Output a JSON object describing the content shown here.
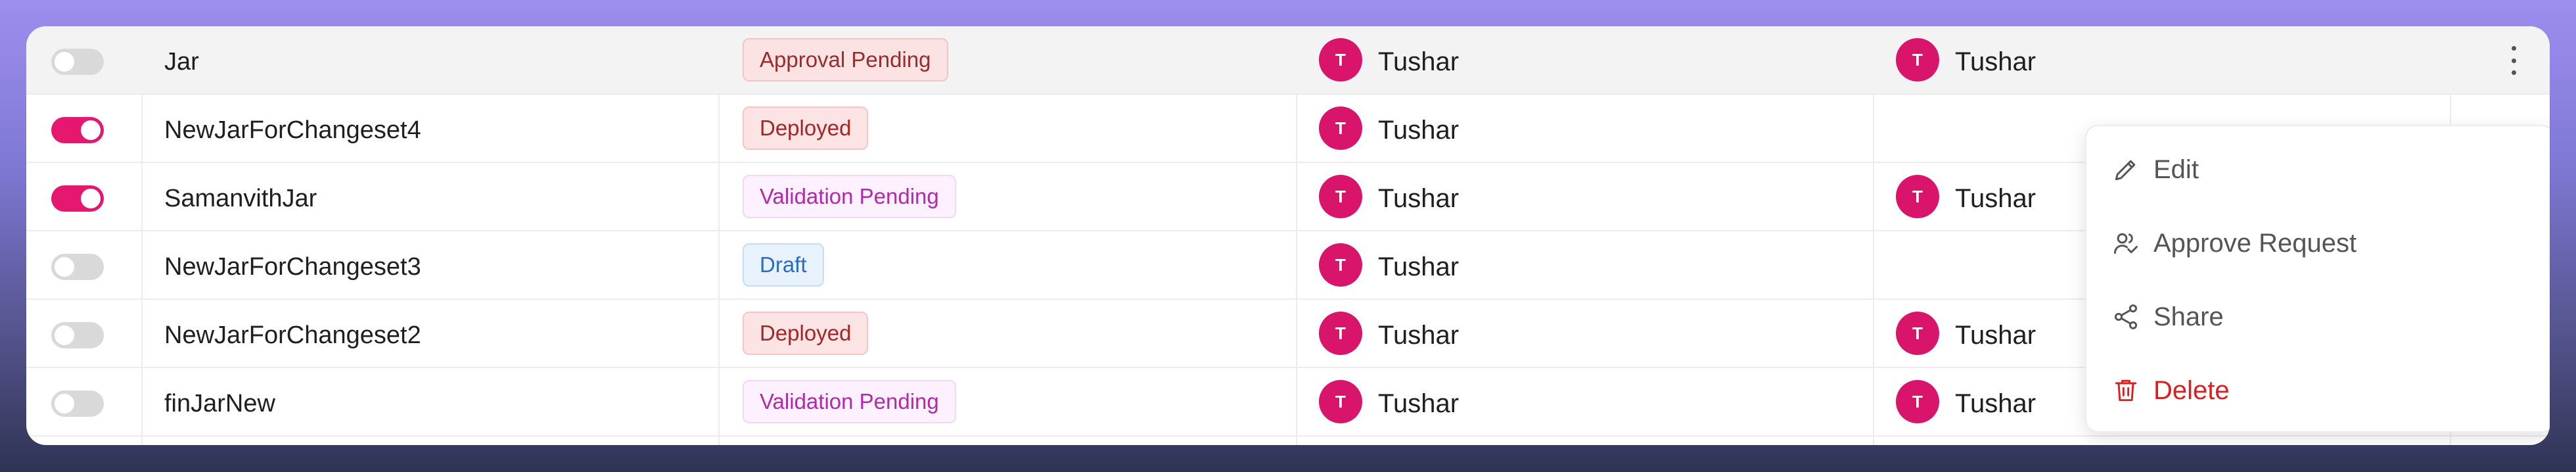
{
  "table": {
    "rows": [
      {
        "enabled": false,
        "name": "Jar",
        "status": "Approval Pending",
        "status_kind": "approval",
        "created_by": {
          "initial": "T",
          "name": "Tushar"
        },
        "approved_by": {
          "initial": "T",
          "name": "Tushar"
        }
      },
      {
        "enabled": true,
        "name": "NewJarForChangeset4",
        "status": "Deployed",
        "status_kind": "deployed",
        "created_by": {
          "initial": "T",
          "name": "Tushar"
        },
        "approved_by": null
      },
      {
        "enabled": true,
        "name": "SamanvithJar",
        "status": "Validation Pending",
        "status_kind": "validation",
        "created_by": {
          "initial": "T",
          "name": "Tushar"
        },
        "approved_by": {
          "initial": "T",
          "name": "Tushar"
        }
      },
      {
        "enabled": false,
        "name": "NewJarForChangeset3",
        "status": "Draft",
        "status_kind": "draft",
        "created_by": {
          "initial": "T",
          "name": "Tushar"
        },
        "approved_by": null
      },
      {
        "enabled": false,
        "name": "NewJarForChangeset2",
        "status": "Deployed",
        "status_kind": "deployed",
        "created_by": {
          "initial": "T",
          "name": "Tushar"
        },
        "approved_by": {
          "initial": "T",
          "name": "Tushar"
        }
      },
      {
        "enabled": false,
        "name": "finJarNew",
        "status": "Validation Pending",
        "status_kind": "validation",
        "created_by": {
          "initial": "T",
          "name": "Tushar"
        },
        "approved_by": {
          "initial": "T",
          "name": "Tushar"
        }
      }
    ]
  },
  "context_menu": {
    "items": [
      {
        "label": "Edit",
        "icon": "pencil-icon"
      },
      {
        "label": "Approve Request",
        "icon": "users-check-icon"
      },
      {
        "label": "Share",
        "icon": "share-icon"
      },
      {
        "label": "Delete",
        "icon": "trash-icon",
        "danger": true
      }
    ]
  },
  "colors": {
    "toggle_on": "#e5176f",
    "avatar": "#d8146b",
    "danger": "#d92020"
  }
}
